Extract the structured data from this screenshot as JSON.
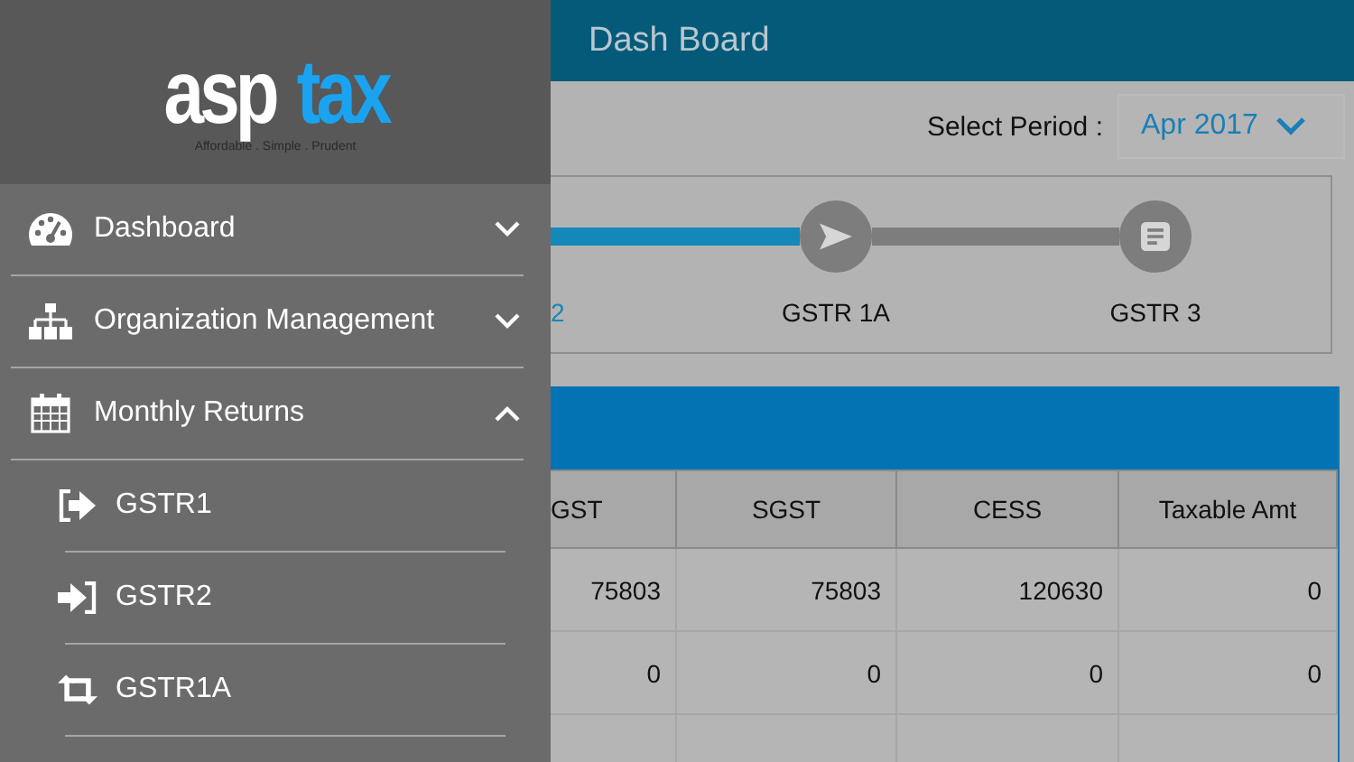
{
  "drawer": {
    "logo": {
      "part_1": "asp",
      "part_2": "tax",
      "tagline": "Affordable . Simple . Prudent"
    },
    "menu": [
      {
        "label": "Dashboard",
        "expanded": false
      },
      {
        "label": "Organization Management",
        "expanded": false
      },
      {
        "label": "Monthly Returns",
        "expanded": true,
        "children": [
          {
            "label": "GSTR1"
          },
          {
            "label": "GSTR2"
          },
          {
            "label": "GSTR1A"
          }
        ]
      }
    ]
  },
  "header": {
    "title": "Dash Board"
  },
  "period": {
    "label": "Select Period :",
    "value": "Apr 2017"
  },
  "steps": [
    {
      "label": "2",
      "done": true
    },
    {
      "label": "GSTR 1A",
      "done": false
    },
    {
      "label": "GSTR 3",
      "done": false
    }
  ],
  "table": {
    "columns": [
      "GST",
      "SGST",
      "CESS",
      "Taxable Amt"
    ],
    "rows": [
      [
        "75803",
        "75803",
        "120630",
        "0"
      ],
      [
        "0",
        "0",
        "0",
        "0"
      ]
    ]
  }
}
